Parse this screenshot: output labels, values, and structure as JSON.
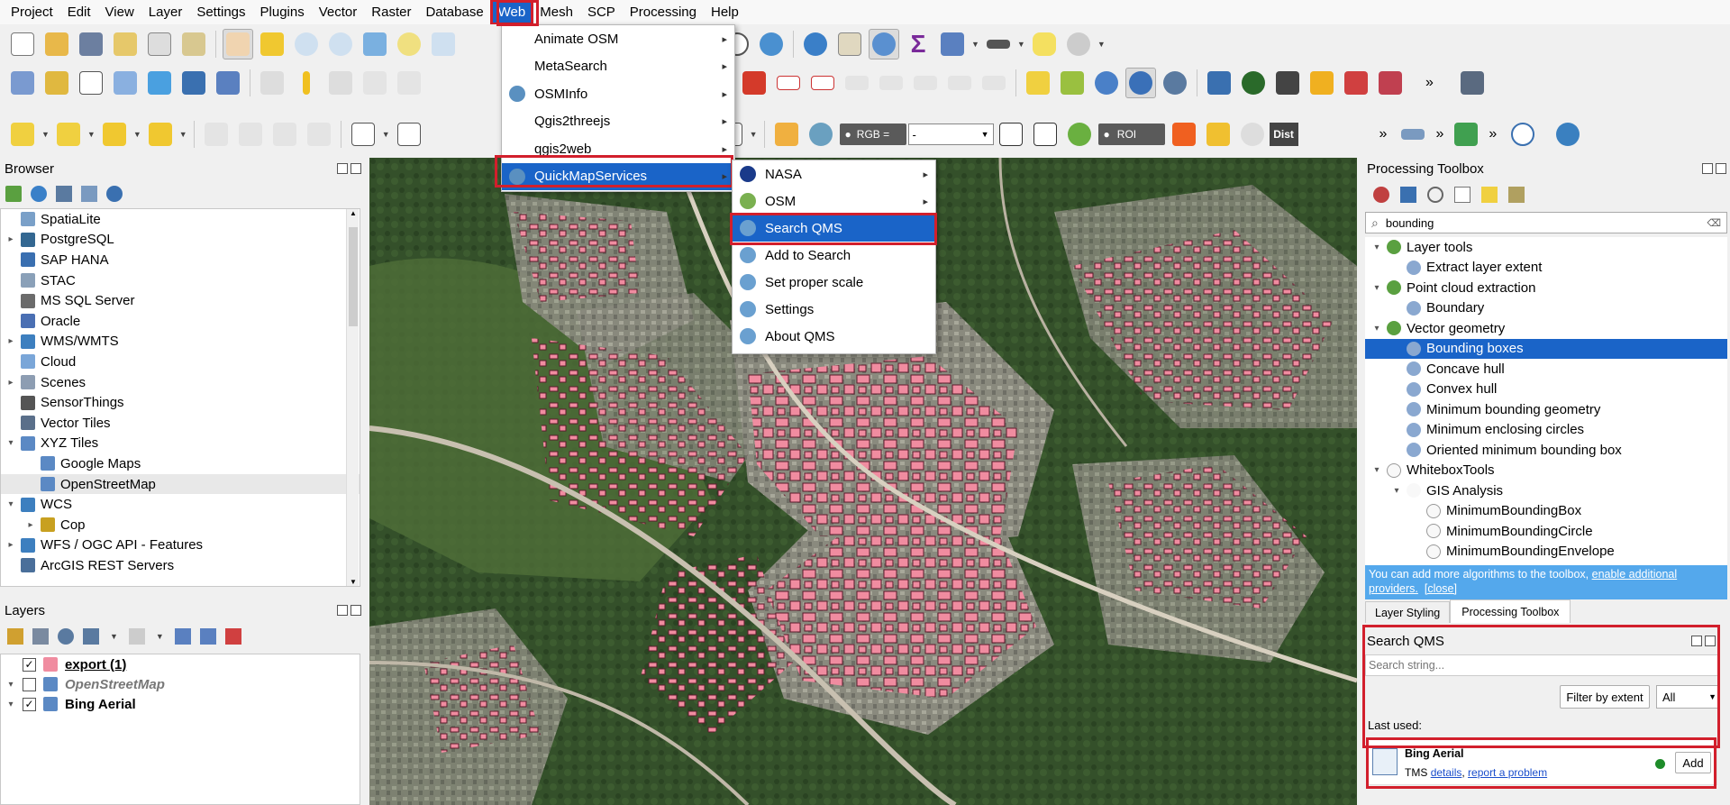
{
  "menubar": [
    "Project",
    "Edit",
    "View",
    "Layer",
    "Settings",
    "Plugins",
    "Vector",
    "Raster",
    "Database",
    "Web",
    "Mesh",
    "SCP",
    "Processing",
    "Help"
  ],
  "toolbar3": {
    "rgb_label": "RGB =",
    "rgb_value": "-",
    "roi_label": "ROI",
    "dist_label": "Dist"
  },
  "browser": {
    "title": "Browser",
    "items": [
      {
        "label": "SpatiaLite",
        "expander": "",
        "indent": 0,
        "color": "#7aa0c8"
      },
      {
        "label": "PostgreSQL",
        "expander": "▸",
        "indent": 0,
        "color": "#336791"
      },
      {
        "label": "SAP HANA",
        "expander": "",
        "indent": 0,
        "color": "#3a6fb0"
      },
      {
        "label": "STAC",
        "expander": "",
        "indent": 0,
        "color": "#8aa0b8"
      },
      {
        "label": "MS SQL Server",
        "expander": "",
        "indent": 0,
        "color": "#6b6b6b"
      },
      {
        "label": "Oracle",
        "expander": "",
        "indent": 0,
        "color": "#4a6fb3"
      },
      {
        "label": "WMS/WMTS",
        "expander": "▸",
        "indent": 0,
        "color": "#3d7fbf"
      },
      {
        "label": "Cloud",
        "expander": "",
        "indent": 0,
        "color": "#7aa6d8"
      },
      {
        "label": "Scenes",
        "expander": "▸",
        "indent": 0,
        "color": "#8d9db2"
      },
      {
        "label": "SensorThings",
        "expander": "",
        "indent": 0,
        "color": "#555555"
      },
      {
        "label": "Vector Tiles",
        "expander": "",
        "indent": 0,
        "color": "#5a6f8a"
      },
      {
        "label": "XYZ Tiles",
        "expander": "▾",
        "indent": 0,
        "color": "#5b89c4"
      },
      {
        "label": "Google Maps",
        "expander": "",
        "indent": 1,
        "color": "#5b89c4"
      },
      {
        "label": "OpenStreetMap",
        "expander": "",
        "indent": 1,
        "color": "#5b89c4"
      },
      {
        "label": "WCS",
        "expander": "▾",
        "indent": 0,
        "color": "#3d7fbf"
      },
      {
        "label": "Cop",
        "expander": "▸",
        "indent": 1,
        "color": "#c8a020"
      },
      {
        "label": "WFS / OGC API - Features",
        "expander": "▸",
        "indent": 0,
        "color": "#3d7fbf"
      },
      {
        "label": "ArcGIS REST Servers",
        "expander": "",
        "indent": 0,
        "color": "#4a6f9a"
      }
    ]
  },
  "layers": {
    "title": "Layers",
    "items": [
      {
        "label": "export (1)",
        "checked": "✓",
        "expander": "",
        "style": "bu",
        "color": "#f08ca0"
      },
      {
        "label": "OpenStreetMap",
        "checked": "",
        "expander": "▾",
        "style": "it",
        "color": "#5b89c4"
      },
      {
        "label": "Bing Aerial",
        "checked": "✓",
        "expander": "▾",
        "style": "b",
        "color": "#5b89c4"
      }
    ]
  },
  "web_menu": {
    "items": [
      {
        "label": "Animate OSM",
        "sub": "▸"
      },
      {
        "label": "MetaSearch",
        "sub": "▸"
      },
      {
        "label": "OSMInfo",
        "sub": "▸"
      },
      {
        "label": "Qgis2threejs",
        "sub": "▸"
      },
      {
        "label": "qgis2web",
        "sub": "▸"
      },
      {
        "label": "QuickMapServices",
        "sub": "▸"
      }
    ]
  },
  "qms_menu": {
    "items": [
      {
        "label": "NASA",
        "sub": "▸"
      },
      {
        "label": "OSM",
        "sub": "▸"
      },
      {
        "label": "Search QMS",
        "sub": ""
      },
      {
        "label": "Add to Search",
        "sub": ""
      },
      {
        "label": "Set proper scale",
        "sub": ""
      },
      {
        "label": "Settings",
        "sub": ""
      },
      {
        "label": "About QMS",
        "sub": ""
      }
    ]
  },
  "toolbox": {
    "title": "Processing Toolbox",
    "search_value": "bounding",
    "items": [
      {
        "label": "Layer tools",
        "expander": "▾",
        "level": 0
      },
      {
        "label": "Extract layer extent",
        "expander": "",
        "level": 1
      },
      {
        "label": "Point cloud extraction",
        "expander": "▾",
        "level": 0
      },
      {
        "label": "Boundary",
        "expander": "",
        "level": 1
      },
      {
        "label": "Vector geometry",
        "expander": "▾",
        "level": 0
      },
      {
        "label": "Bounding boxes",
        "expander": "",
        "level": 1
      },
      {
        "label": "Concave hull",
        "expander": "",
        "level": 1
      },
      {
        "label": "Convex hull",
        "expander": "",
        "level": 1
      },
      {
        "label": "Minimum bounding geometry",
        "expander": "",
        "level": 1
      },
      {
        "label": "Minimum enclosing circles",
        "expander": "",
        "level": 1
      },
      {
        "label": "Oriented minimum bounding box",
        "expander": "",
        "level": 1
      },
      {
        "label": "WhiteboxTools",
        "expander": "▾",
        "level": 0
      },
      {
        "label": "GIS Analysis",
        "expander": "▾",
        "level": 1
      },
      {
        "label": "MinimumBoundingBox",
        "expander": "",
        "level": 2
      },
      {
        "label": "MinimumBoundingCircle",
        "expander": "",
        "level": 2
      },
      {
        "label": "MinimumBoundingEnvelope",
        "expander": "",
        "level": 2
      }
    ],
    "info_text": "You can add more algorithms to the toolbox,",
    "info_link1": "enable additional",
    "info_link2": "providers.",
    "info_close": "[close]"
  },
  "tabs": [
    "Layer Styling",
    "Processing Toolbox"
  ],
  "qms": {
    "title": "Search QMS",
    "placeholder": "Search string...",
    "filter_button": "Filter by extent",
    "select_value": "All",
    "last_used": "Last used:",
    "result_name": "Bing Aerial",
    "result_type": "TMS",
    "details_link": "details",
    "report_link": "report a problem",
    "add_button": "Add",
    "status_color": "#1e8c2a"
  },
  "colors": {
    "selection": "#1a64c8",
    "highlight": "#d21f2c",
    "building": "#f08ca0",
    "info_bg": "#54a8ec"
  }
}
